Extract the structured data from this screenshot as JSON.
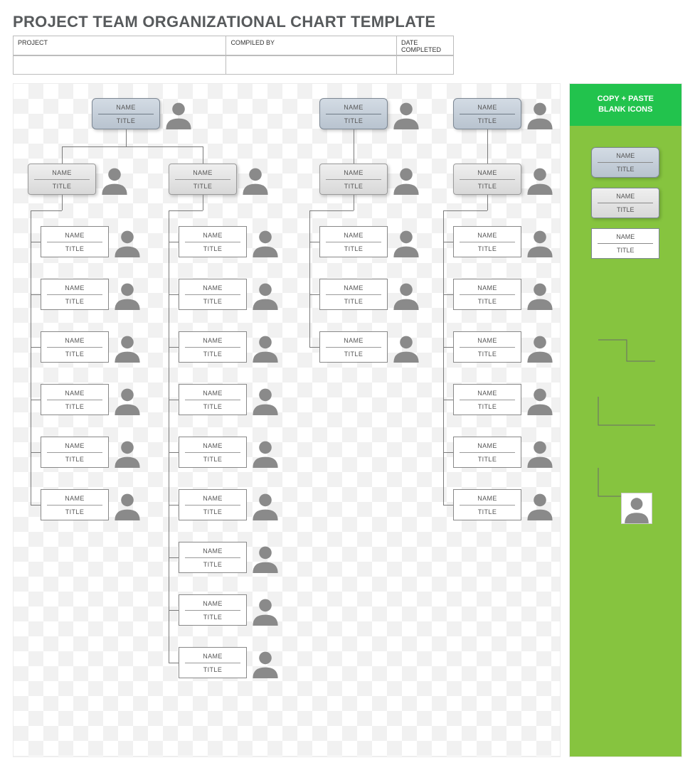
{
  "title": "PROJECT TEAM ORGANIZATIONAL CHART TEMPLATE",
  "meta": {
    "project_label": "PROJECT",
    "compiled_label": "COMPILED BY",
    "date_label": "DATE COMPLETED",
    "project_value": "",
    "compiled_value": "",
    "date_value": ""
  },
  "labels": {
    "name": "NAME",
    "title": "TITLE"
  },
  "side": {
    "header_line1": "COPY + PASTE",
    "header_line2": "BLANK ICONS"
  },
  "chart_data": {
    "type": "org-chart",
    "structure": [
      {
        "id": "root-left",
        "name": "NAME",
        "title": "TITLE",
        "children": [
          {
            "id": "mid-1",
            "name": "NAME",
            "title": "TITLE",
            "children": [
              {
                "name": "NAME",
                "title": "TITLE"
              },
              {
                "name": "NAME",
                "title": "TITLE"
              },
              {
                "name": "NAME",
                "title": "TITLE"
              },
              {
                "name": "NAME",
                "title": "TITLE"
              },
              {
                "name": "NAME",
                "title": "TITLE"
              },
              {
                "name": "NAME",
                "title": "TITLE"
              }
            ]
          },
          {
            "id": "mid-2",
            "name": "NAME",
            "title": "TITLE",
            "children": [
              {
                "name": "NAME",
                "title": "TITLE"
              },
              {
                "name": "NAME",
                "title": "TITLE"
              },
              {
                "name": "NAME",
                "title": "TITLE"
              },
              {
                "name": "NAME",
                "title": "TITLE"
              },
              {
                "name": "NAME",
                "title": "TITLE"
              },
              {
                "name": "NAME",
                "title": "TITLE"
              },
              {
                "name": "NAME",
                "title": "TITLE"
              },
              {
                "name": "NAME",
                "title": "TITLE"
              },
              {
                "name": "NAME",
                "title": "TITLE"
              }
            ]
          }
        ]
      },
      {
        "id": "root-mid",
        "name": "NAME",
        "title": "TITLE",
        "children": [
          {
            "id": "mid-3",
            "name": "NAME",
            "title": "TITLE",
            "children": [
              {
                "name": "NAME",
                "title": "TITLE"
              },
              {
                "name": "NAME",
                "title": "TITLE"
              },
              {
                "name": "NAME",
                "title": "TITLE"
              }
            ]
          }
        ]
      },
      {
        "id": "root-right",
        "name": "NAME",
        "title": "TITLE",
        "children": [
          {
            "id": "mid-4",
            "name": "NAME",
            "title": "TITLE",
            "children": [
              {
                "name": "NAME",
                "title": "TITLE"
              },
              {
                "name": "NAME",
                "title": "TITLE"
              },
              {
                "name": "NAME",
                "title": "TITLE"
              },
              {
                "name": "NAME",
                "title": "TITLE"
              },
              {
                "name": "NAME",
                "title": "TITLE"
              },
              {
                "name": "NAME",
                "title": "TITLE"
              }
            ]
          }
        ]
      }
    ],
    "side_templates": [
      "top",
      "mid",
      "leaf",
      "elbow",
      "elbow",
      "elbow",
      "avatar"
    ]
  }
}
